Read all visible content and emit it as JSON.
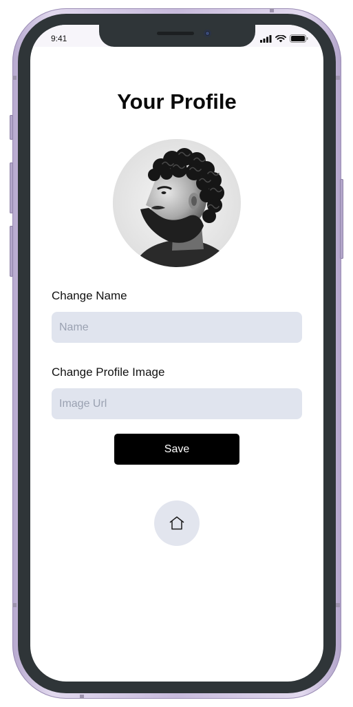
{
  "status_bar": {
    "time": "9:41"
  },
  "profile": {
    "title": "Your Profile",
    "avatar_icon": "profile-photo"
  },
  "form": {
    "name_label": "Change Name",
    "name_placeholder": "Name",
    "image_label": "Change Profile Image",
    "image_placeholder": "Image Url",
    "save_label": "Save"
  },
  "nav": {
    "home_icon": "home-icon"
  },
  "colors": {
    "input_bg": "#e0e4ee",
    "button_bg": "#000000",
    "home_bg": "#e2e5ee",
    "frame": "#c8bbdc"
  }
}
